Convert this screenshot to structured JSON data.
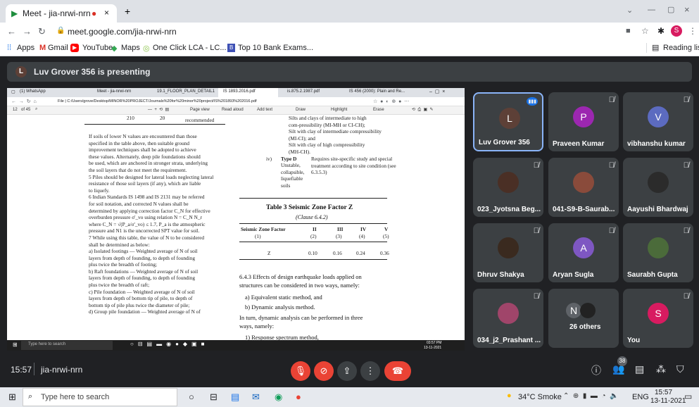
{
  "browser": {
    "tab_title": "Meet - jia-nrwi-nrn",
    "url": "meet.google.com/jia-nrwi-nrn",
    "profile": "S",
    "bookmarks": [
      "Apps",
      "Gmail",
      "YouTube",
      "Maps",
      "One Click LCA - LC...",
      "Top 10 Bank Exams..."
    ],
    "reading_list": "Reading list"
  },
  "banner": {
    "initial": "L",
    "text": "Luv Grover 356 is presenting"
  },
  "shared": {
    "tabs": [
      "(1) WhatsApp",
      "Meet - jia-nrwi-nrn",
      "19.1_FLOOR_PLAN_DETAIL1",
      "IS 1893.2016.pdf",
      "is.875.2.1987.pdf",
      "IS 456 (2000): Plain and Re..."
    ],
    "url": "File | C:/Users/grove/Desktop/MINOR%20PROJECT/Journals%20for%20minor%20project/IS%201893%202016.pdf",
    "page": "12",
    "of": "of 45",
    "tools": [
      "Page view",
      "Read aloud",
      "Add text",
      "Draw",
      "Highlight",
      "Erase"
    ],
    "left_lines": [
      "If soils of lower N values are encountered than those",
      "specified in the table above, then suitable ground",
      "improvement techniques shall be adopted to achieve",
      "these values. Alternately, deep pile foundations should",
      "be used, which are anchored in stronger strata, underlying",
      "the soil layers that do not meet the requirement.",
      "5 Piles should be designed for lateral loads neglecting lateral",
      "resistance of those soil layers (if any), which are liable",
      "to liquefy.",
      "6 Indian Standards IS 1498 and IS 2131 may be referred",
      "for soil notation, and corrected N values shall be",
      "determined by applying correction factor C_N for effective",
      "overburden pressure σ'_vo using relation N = C_N N_r",
      "where C_N = √(P_a/σ'_vo) ≤ 1.7, P_a is the atmospheric",
      "pressure and N1 is the uncorrected SPT value for soil.",
      "7 While using this table, the value of N to be considered",
      "shall be determined as below:",
      "a) Isolated footings — Weighted average of N of soil",
      "layers from depth of founding, to depth of founding",
      "plus twice the breadth of footing;",
      "b) Raft foundations — Weighted average of N of soil",
      "layers from depth of founding, to depth of founding",
      "plus twice the breadth of raft;",
      "c) Pile foundation — Weighted average of N of soil",
      "layers from depth of bottom tip of pile, to depth of",
      "bottom tip of pile plus twice the diameter of pile;",
      "d) Group pile foundation — Weighted average of N of"
    ],
    "top_cells": [
      "210",
      "20",
      "recommended"
    ],
    "right_lines": [
      "Silts and clays of intermediate to high",
      "com-pressibility (MI-MH or CI-CH);",
      "Silt with clay of intermediate compressibility",
      "(MI-CI); and",
      "Silt with clay of high compressibility",
      "(MH-CH)."
    ],
    "type_d": {
      "num": "iv)",
      "title": "Type D",
      "desc": [
        "Unstable,",
        "collapsible,",
        "liquefiable",
        "soils"
      ],
      "req": [
        "Requires site-specific study and special",
        "treatment according to site condition (see",
        "6.3.5.3)"
      ]
    },
    "table_title": "Table 3 Seismic Zone Factor Z",
    "table_clause": "(Clause 6.4.2)",
    "table_head": [
      "Seismic Zone Factor",
      "II",
      "III",
      "IV",
      "V"
    ],
    "table_sub": [
      "(1)",
      "(2)",
      "(3)",
      "(4)",
      "(5)"
    ],
    "table_row": [
      "Z",
      "0.10",
      "0.16",
      "0.24",
      "0.36"
    ],
    "sec": "6.4.3 Effects of design earthquake loads applied on",
    "sec2": "structures can be considered in two ways, namely:",
    "items": [
      "a)  Equivalent static method, and",
      "b)  Dynamic analysis method."
    ],
    "turn": [
      "In turn, dynamic analysis can be performed in three",
      "ways, namely:"
    ],
    "resp": "1)  Response spectrum method,",
    "win_search": "Type here to search",
    "win_time": "03:57 PM",
    "win_date": "13-11-2021"
  },
  "participants": [
    {
      "name": "Luv Grover 356",
      "initial": "L",
      "color": "#5d4037"
    },
    {
      "name": "Praveen Kumar",
      "initial": "P",
      "color": "#9c27b0"
    },
    {
      "name": "vibhanshu kumar",
      "initial": "V",
      "color": "#5c6bc0"
    },
    {
      "name": "023_Jyotsna Beg..."
    },
    {
      "name": "041-S9-B-Saurab..."
    },
    {
      "name": "Aayushi Bhardwaj"
    },
    {
      "name": "Dhruv Shakya"
    },
    {
      "name": "Aryan Sugla",
      "initial": "A",
      "color": "#7e57c2"
    },
    {
      "name": "Saurabh Gupta"
    },
    {
      "name": "034_j2_Prashant ..."
    },
    {
      "name": "26 others",
      "initial": "N"
    },
    {
      "name": "You",
      "initial": "S",
      "color": "#d81b60"
    }
  ],
  "meeting": {
    "time": "15:57",
    "code": "jia-nrwi-nrn",
    "people_count": "38"
  },
  "taskbar": {
    "search": "Type here to search",
    "weather": "34°C Smoke",
    "lang": "ENG",
    "time": "15:57",
    "date": "13-11-2021"
  }
}
